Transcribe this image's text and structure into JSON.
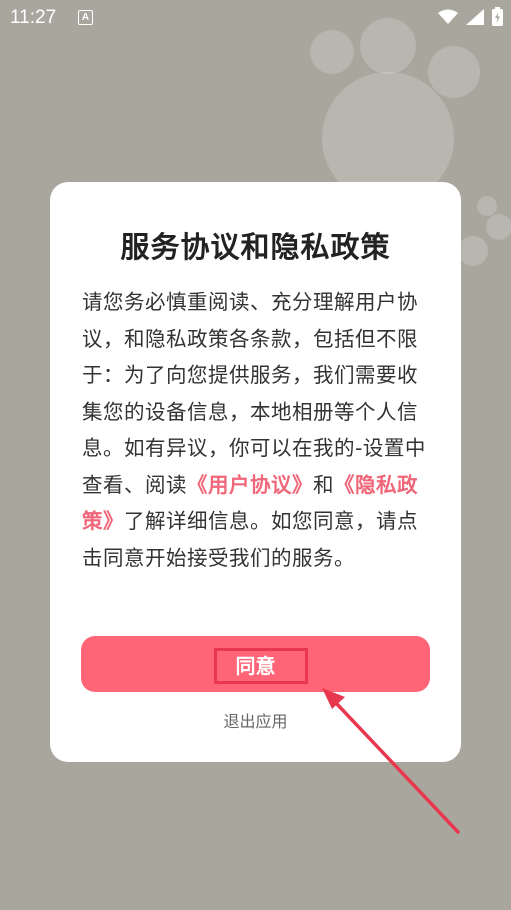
{
  "status_bar": {
    "time": "11:27",
    "notification_icon": "a-icon",
    "wifi_icon": "wifi-icon",
    "signal_icon": "signal-icon",
    "battery_icon": "battery-charging-icon"
  },
  "dialog": {
    "title": "服务协议和隐私政策",
    "body_part1": "请您务必慎重阅读、充分理解用户协议，和隐私政策各条款，包括但不限于：为了向您提供服务，我们需要收集您的设备信息，本地相册等个人信息。如有异议，你可以在我的-设置中查看、阅读",
    "user_agreement_link": "《用户协议》",
    "body_and": "和",
    "privacy_policy_link": "《隐私政策》",
    "body_part2": "了解详细信息。如您同意，请点击同意开始接受我们的服务。",
    "agree_button": "同意",
    "exit_link": "退出应用"
  },
  "colors": {
    "accent": "#ff6577",
    "link": "#f0677a",
    "annotation": "#e8384f",
    "background": "#a9a69e"
  }
}
